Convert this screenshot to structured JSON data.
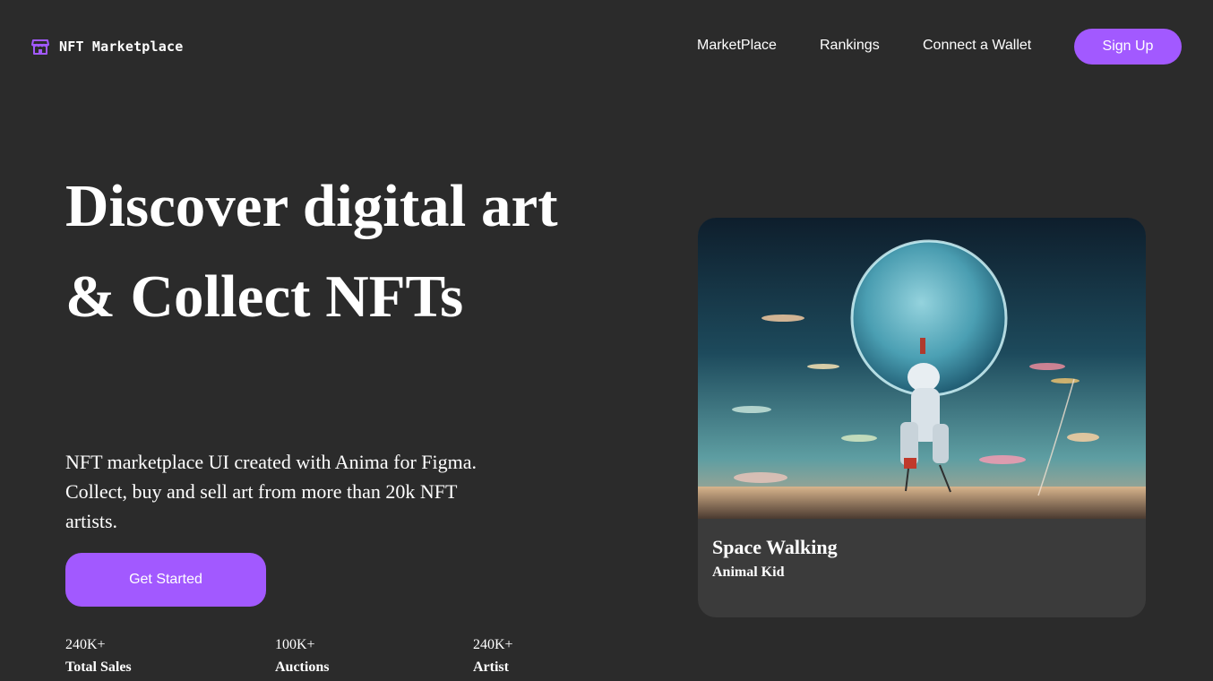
{
  "header": {
    "brand_name": "NFT Marketplace",
    "brand_icon": "storefront-icon",
    "nav": [
      "MarketPlace",
      "Rankings",
      "Connect a Wallet"
    ],
    "signup_label": "Sign Up"
  },
  "hero": {
    "title": "Discover digital art & Collect NFTs",
    "description": "NFT marketplace UI created with Anima for Figma. Collect, buy and sell art from more than 20k NFT artists.",
    "cta_label": "Get Started",
    "stats": [
      {
        "value": "240K+",
        "label": "Total Sales"
      },
      {
        "value": "100K+",
        "label": "Auctions"
      },
      {
        "value": "240K+",
        "label": "Artist"
      }
    ]
  },
  "featured": {
    "title": "Space Walking",
    "artist": "Animal Kid"
  },
  "colors": {
    "background": "#2b2b2b",
    "accent": "#a259ff",
    "card": "#3b3b3b"
  }
}
